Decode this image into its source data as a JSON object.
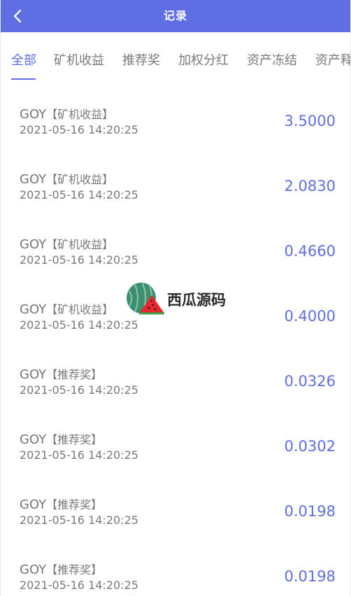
{
  "header": {
    "title": "记录",
    "back_icon": "chevron-left-icon"
  },
  "tabs": [
    {
      "label": "全部",
      "active": true
    },
    {
      "label": "矿机收益",
      "active": false
    },
    {
      "label": "推荐奖",
      "active": false
    },
    {
      "label": "加权分红",
      "active": false
    },
    {
      "label": "资产冻结",
      "active": false
    },
    {
      "label": "资产释",
      "active": false
    }
  ],
  "records": [
    {
      "coin": "GOY",
      "type": "【矿机收益】",
      "time": "2021-05-16 14:20:25",
      "amount": "3.5000"
    },
    {
      "coin": "GOY",
      "type": "【矿机收益】",
      "time": "2021-05-16 14:20:25",
      "amount": "2.0830"
    },
    {
      "coin": "GOY",
      "type": "【矿机收益】",
      "time": "2021-05-16 14:20:25",
      "amount": "0.4660"
    },
    {
      "coin": "GOY",
      "type": "【矿机收益】",
      "time": "2021-05-16 14:20:25",
      "amount": "0.4000"
    },
    {
      "coin": "GOY",
      "type": "【推荐奖】",
      "time": "2021-05-16 14:20:25",
      "amount": "0.0326"
    },
    {
      "coin": "GOY",
      "type": "【推荐奖】",
      "time": "2021-05-16 14:20:25",
      "amount": "0.0302"
    },
    {
      "coin": "GOY",
      "type": "【推荐奖】",
      "time": "2021-05-16 14:20:25",
      "amount": "0.0198"
    },
    {
      "coin": "GOY",
      "type": "【推荐奖】",
      "time": "2021-05-16 14:20:25",
      "amount": "0.0198"
    }
  ],
  "watermark": {
    "text": "西瓜源码",
    "icon": "watermelon-logo-icon"
  },
  "colors": {
    "accent": "#5f6fe3",
    "text_gray": "#7a7a7a",
    "header_text": "#ffffff"
  }
}
